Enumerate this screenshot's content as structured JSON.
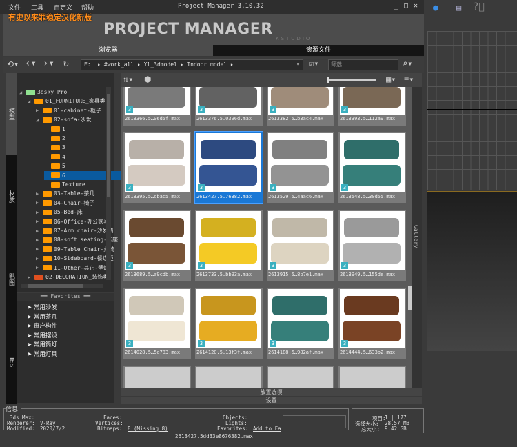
{
  "menu": [
    "文件",
    "工具",
    "自定义",
    "帮助"
  ],
  "window_title": "Project Manager 3.10.32",
  "promo": "有史以来罪稳定汉化新版",
  "logo": {
    "text": "PROJECT MANAGER",
    "sub": "KSTUDIO"
  },
  "tabs": [
    {
      "label": "浏览器",
      "active": true
    },
    {
      "label": "资源文件",
      "active": false
    }
  ],
  "path": [
    "E:",
    "#work_all",
    "Yl_3dmodel",
    "Indoor model"
  ],
  "filter_placeholder": "筛选",
  "vertical_tabs": [
    "模型",
    "材质",
    "贴图",
    "IES"
  ],
  "tree": [
    {
      "label": "3dsky_Pro",
      "level": 0,
      "color": "#90e090",
      "expanded": true
    },
    {
      "label": "01_FURNITURE_家具类",
      "level": 1,
      "expanded": true
    },
    {
      "label": "01-cabinet-柜子",
      "level": 2
    },
    {
      "label": "02-sofa-沙发",
      "level": 2,
      "expanded": true
    },
    {
      "label": "1",
      "level": 3
    },
    {
      "label": "2",
      "level": 3
    },
    {
      "label": "3",
      "level": 3
    },
    {
      "label": "4",
      "level": 3
    },
    {
      "label": "5",
      "level": 3
    },
    {
      "label": "6",
      "level": 3,
      "selected": true
    },
    {
      "label": "Texture",
      "level": 3
    },
    {
      "label": "03-Table-茶几",
      "level": 2
    },
    {
      "label": "04-Chair-椅子",
      "level": 2
    },
    {
      "label": "05-Bed-床",
      "level": 2
    },
    {
      "label": "06-Office-办公家具",
      "level": 2
    },
    {
      "label": "07-Arm chair-沙发椅",
      "level": 2
    },
    {
      "label": "08-soft seating-软座",
      "level": 2
    },
    {
      "label": "09-Table Chair-桌椅",
      "level": 2
    },
    {
      "label": "10-Sideboard-餐边柜",
      "level": 2
    },
    {
      "label": "11-Other-其它-壁炉",
      "level": 2
    },
    {
      "label": "02-DECORATION_装饰类",
      "level": 1,
      "color": "#e05020"
    }
  ],
  "favorites_title": "Favorites",
  "favorites": [
    "常用沙发",
    "常用茶几",
    "窗户构件",
    "常用摆设",
    "常用筒灯",
    "常用灯具"
  ],
  "thumbnails": [
    "2613366.5…06d5f.max",
    "2613376.5…0396d.max",
    "2613382.5…b3ac4.max",
    "2613393.5…112a9.max",
    "2613395.5…cbac5.max",
    "2613427.5…76382.max",
    "2613529.5…4aac6.max",
    "2613548.5…30d55.max",
    "2613689.5…a9cdb.max",
    "2613733.5…bb93a.max",
    "2613915.5…8b7e1.max",
    "2613949.5…155de.max",
    "2614028.5…5e783.max",
    "2614120.5…13f3f.max",
    "2614188.5…982af.max",
    "2614444.5…633b2.max"
  ],
  "selected_index": 5,
  "thumb_colors": [
    "#6a6a6a",
    "#555",
    "#8a7a6a",
    "#6a5a4a",
    "#b8b0a8",
    "#2d4a80",
    "#808080",
    "#2f6e6a",
    "#6a4a30",
    "#d4b020",
    "#c0b8a8",
    "#9a9a9a",
    "#d0c8b8",
    "#c8961e",
    "#2f6e6a",
    "#6a3a20"
  ],
  "gallery_label": "Gallery",
  "bars": [
    "放置选项",
    "设置"
  ],
  "info": {
    "title": "信息:",
    "max_label": "3ds Max:",
    "max_value": "",
    "renderer_label": "Renderer:",
    "renderer_value": "V-Ray",
    "modified_label": "Modified:",
    "modified_value": "2020/7/2",
    "faces_label": "Faces:",
    "vertices_label": "Vertices:",
    "bitmaps_label": "Bitmaps:",
    "bitmaps_value": "8 (Missing 8)",
    "objects_label": "Objects:",
    "lights_label": "Lights:",
    "favorites_label": "Favorites:",
    "favorites_value": "Add to Fa",
    "filename": "2613427.5dd33e8676382.max"
  },
  "stats": {
    "items_label": "项目:",
    "items_value": "1 | 177",
    "sel_label": "选择大小:",
    "sel_value": "28.57 MB",
    "total_label": "总大小:",
    "total_value": "9.42 GB"
  }
}
